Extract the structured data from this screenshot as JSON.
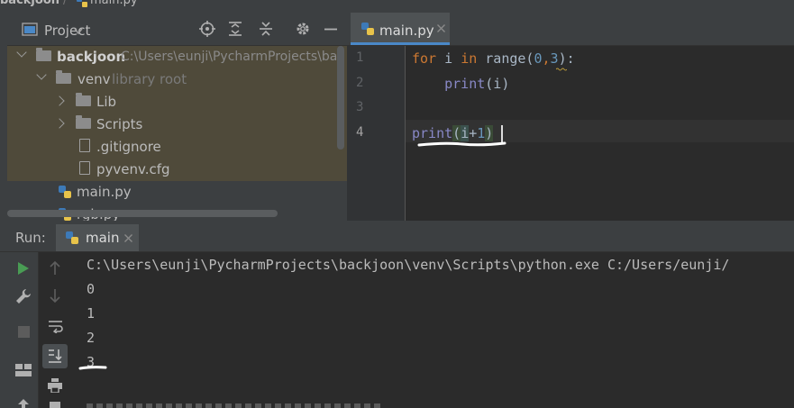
{
  "breadcrumb": {
    "project": "backjoon",
    "file": "main.py"
  },
  "project_panel": {
    "title": "Project",
    "root": {
      "name": "backjoon",
      "path": "C:\\Users\\eunji\\PycharmProjects\\ba"
    },
    "items": [
      {
        "name": "venv",
        "hint": "library root"
      },
      {
        "name": "Lib"
      },
      {
        "name": "Scripts"
      },
      {
        "name": ".gitignore"
      },
      {
        "name": "pyvenv.cfg"
      },
      {
        "name": "main.py"
      },
      {
        "name": "rgb.py"
      }
    ]
  },
  "editor": {
    "tab_label": "main.py",
    "line_numbers": [
      "1",
      "2",
      "3",
      "4"
    ],
    "code": {
      "l1_kw_for": "for",
      "l1_var": " i ",
      "l1_kw_in": "in",
      "l1_range": " range(",
      "l1_n0": "0",
      "l1_comma": ",",
      "l1_n3": "3",
      "l1_end": "):",
      "l2_indent": "    ",
      "l2_print": "print",
      "l2_args": "(i)",
      "l4_print": "print",
      "l4_open": "(",
      "l4_i": "i",
      "l4_plus": "+",
      "l4_one": "1",
      "l4_close": ")"
    }
  },
  "run_panel": {
    "label": "Run:",
    "tab_label": "main",
    "console_lines": [
      "C:\\Users\\eunji\\PycharmProjects\\backjoon\\venv\\Scripts\\python.exe C:/Users/eunji/",
      "0",
      "1",
      "2",
      "3"
    ]
  },
  "colors": {
    "keyword": "#cc7832",
    "builtin": "#8888c6",
    "number": "#6897bb",
    "run_green": "#499c54",
    "accent_blue": "#4a88c7"
  }
}
